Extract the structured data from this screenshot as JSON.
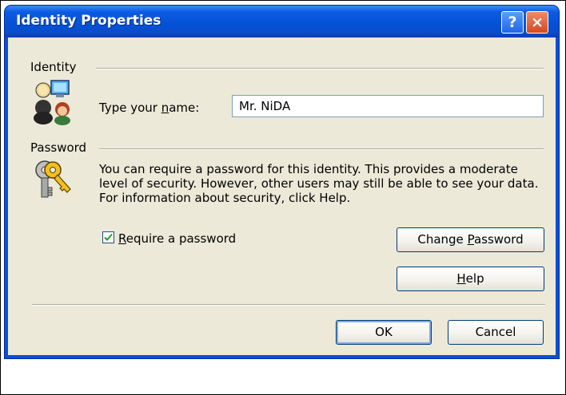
{
  "window": {
    "title": "Identity Properties",
    "help_glyph": "?",
    "close_glyph": "×",
    "colors": {
      "titlebar": "#0551d6",
      "client": "#ece9d8",
      "close": "#d4491f"
    }
  },
  "identity": {
    "section_label": "Identity",
    "icon": "users-icon",
    "name_label_pre": "Type your ",
    "name_label_u": "n",
    "name_label_post": "ame:",
    "name_value": "Mr. NiDA"
  },
  "password": {
    "section_label": "Password",
    "icon": "keys-icon",
    "description": "You can require a password for this identity.  This provides a moderate level of security. However, other users may still be able to see your data. For information about security, click Help.",
    "require_label_u": "R",
    "require_label_post": "equire a password",
    "require_checked": true,
    "change_pre": "Change ",
    "change_u": "P",
    "change_post": "assword",
    "help_u": "H",
    "help_post": "elp"
  },
  "footer": {
    "ok_label": "OK",
    "cancel_label": "Cancel"
  }
}
